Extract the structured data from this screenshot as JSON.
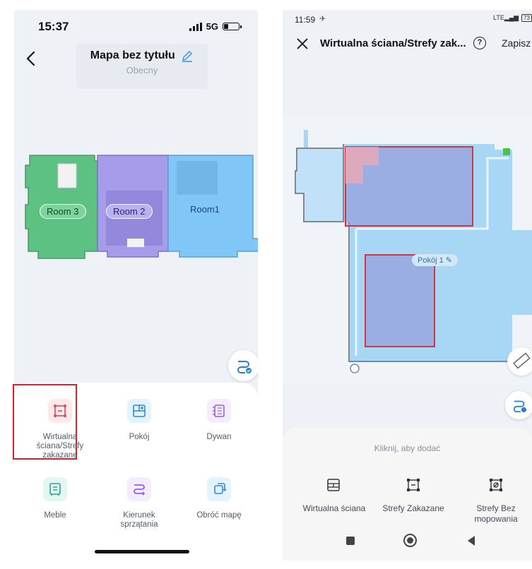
{
  "left_screen": {
    "status": {
      "time": "15:37",
      "network": "5G"
    },
    "header": {
      "title": "Mapa bez tytułu",
      "subtitle": "Obecny"
    },
    "map": {
      "rooms": [
        "Room 3",
        "Room 2",
        "Room1"
      ]
    },
    "tools": [
      {
        "label": "Wirtualna ściana/Strefy zakazane",
        "icon": "virtual-wall-icon",
        "highlighted": true
      },
      {
        "label": "Pokój",
        "icon": "room-edit-icon"
      },
      {
        "label": "Dywan",
        "icon": "carpet-icon"
      },
      {
        "label": "Meble",
        "icon": "furniture-icon"
      },
      {
        "label": "Kierunek sprzątania",
        "icon": "cleaning-direction-icon"
      },
      {
        "label": "Obróć mapę",
        "icon": "rotate-map-icon"
      }
    ],
    "colors": {
      "room3": "#5bbf7f",
      "room2": "#a59ae8",
      "room1": "#7fc4f5",
      "highlight": "#d0242e"
    }
  },
  "right_screen": {
    "status": {
      "time": "11:59",
      "battery": "73"
    },
    "header": {
      "title": "Wirtualna ściana/Strefy zak...",
      "help": "?",
      "save": "Zapisz"
    },
    "map": {
      "room_label": "Pokój 1"
    },
    "hint": "Kliknij, aby dodać",
    "tools": [
      {
        "label": "Wirtualna ściana",
        "icon": "virtual-wall-icon"
      },
      {
        "label": "Strefy Zakazane",
        "icon": "no-go-zone-icon"
      },
      {
        "label": "Strefy Bez mopowania",
        "icon": "no-mop-zone-icon"
      }
    ],
    "colors": {
      "floor": "#9fd2f3",
      "zone": "#d2363f"
    }
  }
}
